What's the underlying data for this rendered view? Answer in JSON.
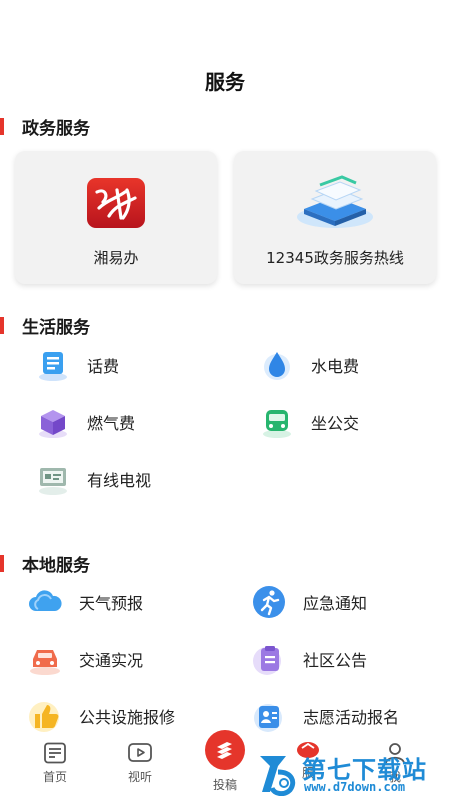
{
  "header": {
    "title": "服务"
  },
  "sections": {
    "gov": {
      "title": "政务服务",
      "cards": [
        {
          "label": "湘易办",
          "icon": "xiangyiban-logo-icon"
        },
        {
          "label": "12345政务服务热线",
          "icon": "hotline-stack-icon"
        }
      ]
    },
    "life": {
      "title": "生活服务",
      "items": [
        {
          "label": "话费",
          "icon": "phone-bill-icon"
        },
        {
          "label": "水电费",
          "icon": "water-drop-icon"
        },
        {
          "label": "燃气费",
          "icon": "gas-box-icon"
        },
        {
          "label": "坐公交",
          "icon": "bus-icon"
        },
        {
          "label": "有线电视",
          "icon": "tv-icon"
        }
      ]
    },
    "local": {
      "title": "本地服务",
      "items": [
        {
          "label": "天气预报",
          "icon": "cloud-icon"
        },
        {
          "label": "应急通知",
          "icon": "running-person-icon"
        },
        {
          "label": "交通实况",
          "icon": "car-icon"
        },
        {
          "label": "社区公告",
          "icon": "clipboard-icon"
        },
        {
          "label": "公共设施报修",
          "icon": "thumbs-up-icon"
        },
        {
          "label": "志愿活动报名",
          "icon": "id-card-icon"
        }
      ]
    }
  },
  "tabbar": {
    "items": [
      {
        "label": "首页",
        "icon": "news-icon"
      },
      {
        "label": "视听",
        "icon": "play-icon"
      },
      {
        "label": "投稿",
        "icon": "submit-icon"
      },
      {
        "label": "服",
        "icon": "service-icon"
      },
      {
        "label": "我",
        "icon": "profile-icon"
      }
    ]
  },
  "watermark": {
    "brand": "第七下载站",
    "url": "www.d7down.com"
  },
  "colors": {
    "accent": "#e5352b",
    "card_bg": "#f2f2f2"
  }
}
